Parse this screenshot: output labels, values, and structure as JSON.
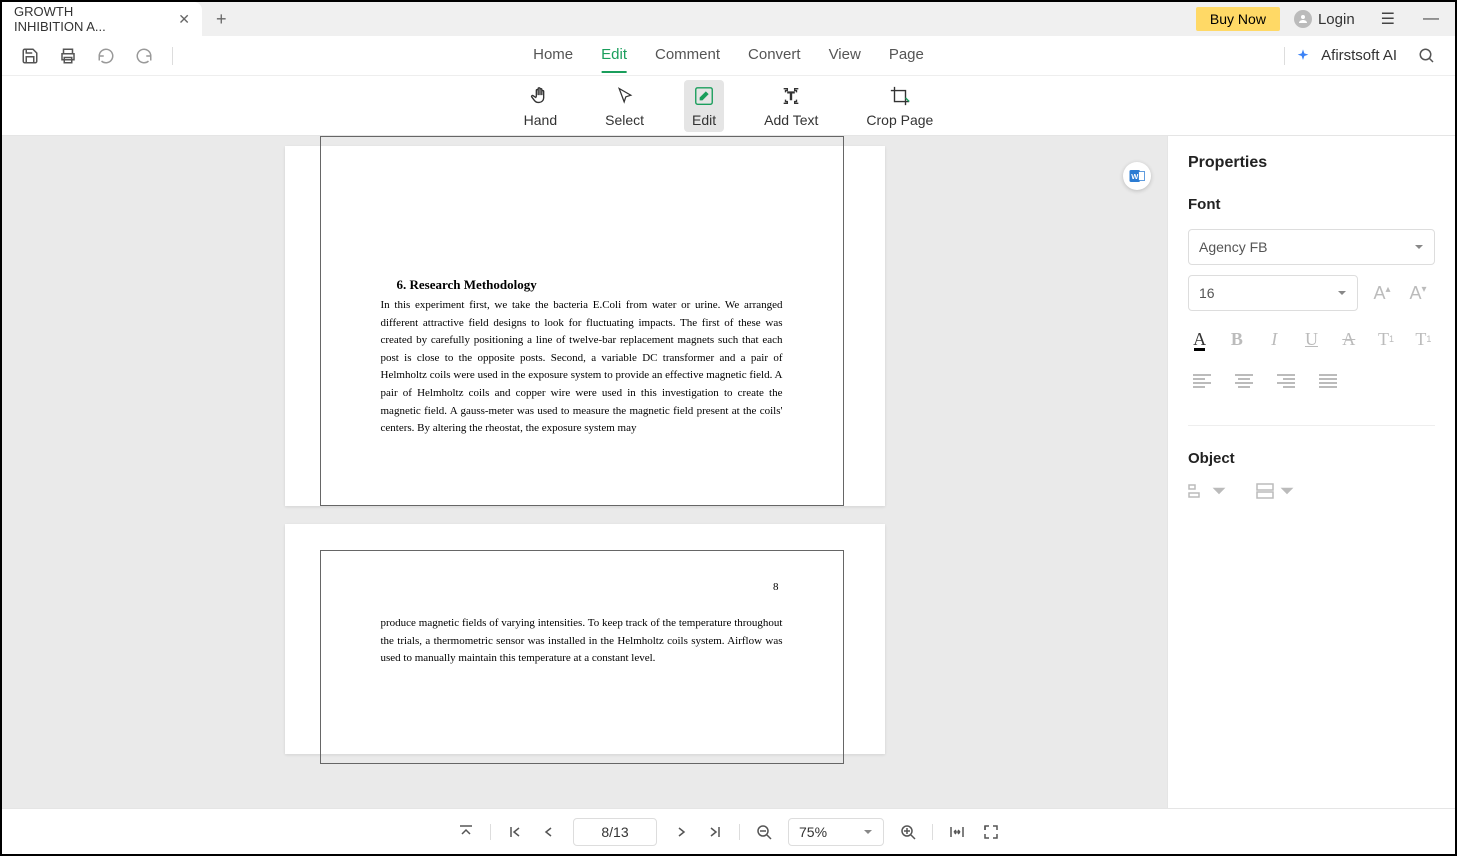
{
  "titlebar": {
    "tab_title": "GROWTH INHIBITION A...",
    "buy_now": "Buy Now",
    "login": "Login"
  },
  "main_tabs": {
    "home": "Home",
    "edit": "Edit",
    "comment": "Comment",
    "convert": "Convert",
    "view": "View",
    "page": "Page"
  },
  "ai_label": "Afirstsoft AI",
  "toolbar": {
    "hand": "Hand",
    "select": "Select",
    "edit": "Edit",
    "add_text": "Add Text",
    "crop_page": "Crop Page"
  },
  "document": {
    "section_title": "6.  Research Methodology",
    "body1": "In this experiment first, we take the bacteria E.Coli from water or urine. We arranged different attractive field designs to look for fluctuating impacts. The first of these was created by carefully positioning a line of twelve-bar replacement magnets such that each post is close to the opposite posts. Second, a variable DC transformer and a pair of Helmholtz coils were used in the exposure system to provide an effective magnetic field. A pair of Helmholtz coils and copper wire were used in this investigation to create the magnetic field. A gauss-meter was used to measure the magnetic field present at the coils' centers. By altering the rheostat, the exposure system may",
    "page_num": "8",
    "body2": "produce magnetic fields of varying intensities. To keep track of the temperature throughout the trials, a thermometric sensor was installed in the Helmholtz coils system. Airflow was used to manually maintain this temperature at a constant level."
  },
  "properties": {
    "title": "Properties",
    "font_label": "Font",
    "font_family": "Agency FB",
    "font_size": "16",
    "object_label": "Object"
  },
  "bottombar": {
    "page_indicator": "8/13",
    "zoom": "75%"
  }
}
